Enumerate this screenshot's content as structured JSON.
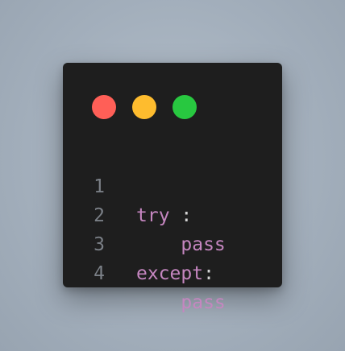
{
  "window": {
    "controls": [
      {
        "name": "close",
        "color": "#ff5f57"
      },
      {
        "name": "minimize",
        "color": "#febc2e"
      },
      {
        "name": "maximize",
        "color": "#28c840"
      }
    ]
  },
  "colors": {
    "background": "#a2aebb",
    "editor_background": "#1e1e1e",
    "keyword": "#c586c0",
    "punctuation": "#d4d4d4",
    "line_number": "#7a7f86"
  },
  "code": {
    "lines": [
      {
        "number": "1",
        "keyword": "try",
        "punct": " :",
        "indent": ""
      },
      {
        "number": "2",
        "keyword": "pass",
        "punct": "",
        "indent": "    "
      },
      {
        "number": "3",
        "keyword": "except",
        "punct": ":",
        "indent": ""
      },
      {
        "number": "4",
        "keyword": "pass",
        "punct": "",
        "indent": "    "
      }
    ]
  }
}
